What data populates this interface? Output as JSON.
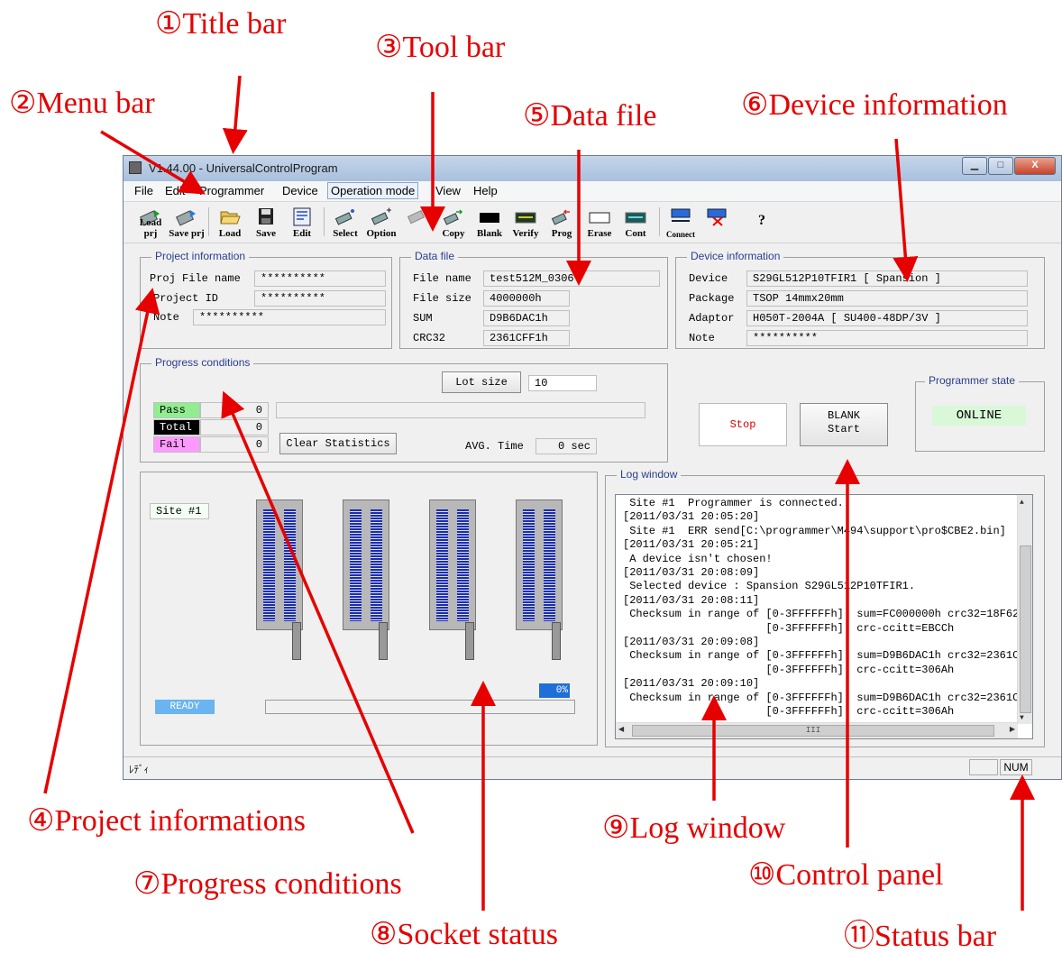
{
  "callouts": {
    "c1": "①Title bar",
    "c2": "②Menu bar",
    "c3": "③Tool bar",
    "c4": "④Project informations",
    "c5": "⑤Data file",
    "c6": "⑥Device information",
    "c7": "⑦Progress conditions",
    "c8": "⑧Socket status",
    "c9": "⑨Log window",
    "c10": "⑩Control panel",
    "c11": "⑪Status bar"
  },
  "window": {
    "title": "V1.44.00 - UniversalControlProgram",
    "buttons": {
      "minimize": "▁",
      "maximize": "□",
      "close": "X"
    }
  },
  "menu": {
    "items": [
      "File",
      "Edit",
      "Programmer",
      "Device",
      "Operation mode",
      "View",
      "Help"
    ],
    "active": "Operation mode"
  },
  "toolbar": {
    "buttons": [
      {
        "label": "Load prj",
        "icon": "load-project-icon"
      },
      {
        "label": "Save prj",
        "icon": "save-project-icon"
      },
      {
        "label": "Load",
        "icon": "folder-open-icon"
      },
      {
        "label": "Save",
        "icon": "floppy-disk-icon"
      },
      {
        "label": "Edit",
        "icon": "edit-icon"
      },
      {
        "label": "Select",
        "icon": "chip-select-icon"
      },
      {
        "label": "Option",
        "icon": "chip-option-icon"
      },
      {
        "label": "",
        "icon": "chip-disabled-icon"
      },
      {
        "label": "Copy",
        "icon": "chip-copy-icon"
      },
      {
        "label": "Blank",
        "icon": "blank-icon"
      },
      {
        "label": "Verify",
        "icon": "verify-icon"
      },
      {
        "label": "Prog",
        "icon": "program-icon"
      },
      {
        "label": "Erase",
        "icon": "erase-icon"
      },
      {
        "label": "Cont",
        "icon": "continuous-icon"
      },
      {
        "label": "Connect",
        "icon": "connect-icon"
      },
      {
        "label": "",
        "icon": "disconnect-icon"
      },
      {
        "label": "?",
        "icon": "help-icon"
      }
    ]
  },
  "project": {
    "title": "Project information",
    "file_name_label": "Proj File name",
    "file_name": "**********",
    "id_label": "Project ID",
    "id": "**********",
    "note_label": "Note",
    "note": "**********"
  },
  "data_file": {
    "title": "Data file",
    "name_label": "File name",
    "name": "test512M_0306",
    "size_label": "File size",
    "size": "4000000h",
    "sum_label": "SUM",
    "sum": "D9B6DAC1h",
    "crc_label": "CRC32",
    "crc": "2361CFF1h"
  },
  "device": {
    "title": "Device information",
    "device_label": "Device",
    "device": "S29GL512P10TFIR1 [ Spansion ]",
    "package_label": "Package",
    "package": "TSOP 14mmx20mm",
    "adaptor_label": "Adaptor",
    "adaptor": "H050T-2004A [ SU400-48DP/3V ]",
    "note_label": "Note",
    "note": "**********"
  },
  "progress": {
    "title": "Progress conditions",
    "lot_size_button": "Lot size",
    "lot_size": "10",
    "pass_label": "Pass",
    "pass": "0",
    "total_label": "Total",
    "total": "0",
    "fail_label": "Fail",
    "fail": "0",
    "clear_button": "Clear Statistics",
    "avg_label": "AVG. Time",
    "avg": "0 sec"
  },
  "control": {
    "stop_button": "Stop",
    "start_button_line1": "BLANK",
    "start_button_line2": "Start",
    "state_title": "Programmer state",
    "state": "ONLINE"
  },
  "socket": {
    "site_label": "Site #1",
    "ready": "READY",
    "percent": "0%",
    "progress_fraction": 0
  },
  "log": {
    "title": "Log window",
    "lines": [
      " Site #1  Programmer is connected.",
      "[2011/03/31 20:05:20]",
      " Site #1  ERR send[C:\\programmer\\M494\\support\\pro$CBE2.bin]",
      "[2011/03/31 20:05:21]",
      " A device isn't chosen!",
      "[2011/03/31 20:08:09]",
      " Selected device : Spansion S29GL512P10TFIR1.",
      "[2011/03/31 20:08:11]",
      " Checksum in range of [0-3FFFFFFh]  sum=FC000000h crc32=18F62",
      "                      [0-3FFFFFFh]  crc-ccitt=EBCCh",
      "[2011/03/31 20:09:08]",
      " Checksum in range of [0-3FFFFFFh]  sum=D9B6DAC1h crc32=2361C",
      "                      [0-3FFFFFFh]  crc-ccitt=306Ah",
      "[2011/03/31 20:09:10]",
      " Checksum in range of [0-3FFFFFFh]  sum=D9B6DAC1h crc32=2361C",
      "                      [0-3FFFFFFh]  crc-ccitt=306Ah"
    ],
    "scroll_glyph": "III"
  },
  "statusbar": {
    "left": "ﾚﾃﾞｨ",
    "num": "NUM"
  }
}
